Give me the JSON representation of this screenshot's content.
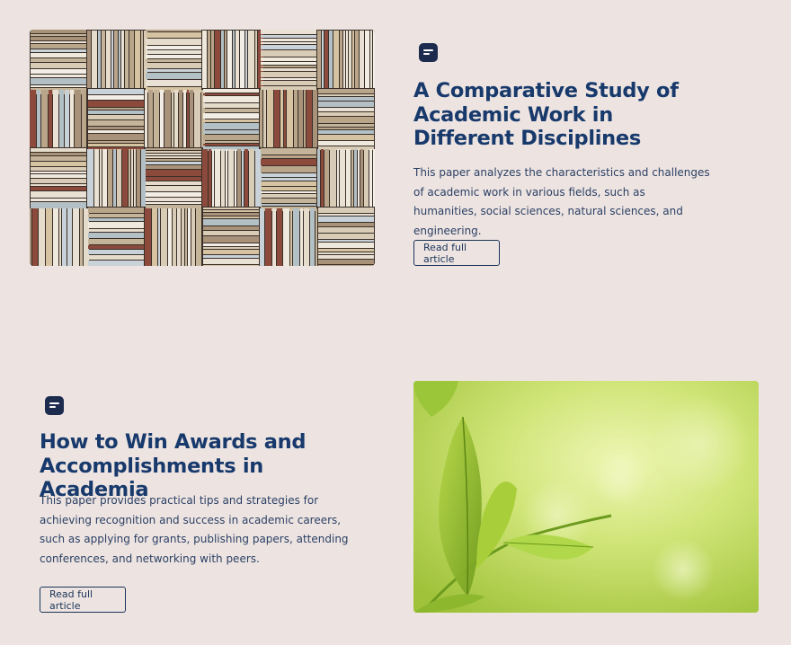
{
  "articles": [
    {
      "icon": "article-icon",
      "title": "A Comparative Study of Academic Work in Different Disciplines",
      "description": "This paper analyzes the characteristics and challenges of academic work in various fields, such as humanities, social sciences, natural sciences, and engineering.",
      "cta_label": "Read full article",
      "image": "books-stack-image"
    },
    {
      "icon": "article-icon",
      "title": "How to Win Awards and Accomplishments in Academia",
      "description": "This paper provides practical tips and strategies for achieving recognition and success in academic careers, such as applying for grants, publishing papers, attending conferences, and networking with peers.",
      "cta_label": "Read full article",
      "image": "green-leaves-image"
    }
  ],
  "colors": {
    "background": "#ede4e2",
    "title": "#17396b",
    "text": "#2a3f63",
    "icon_bg": "#1d2b4f",
    "button_border": "#1b3358"
  }
}
